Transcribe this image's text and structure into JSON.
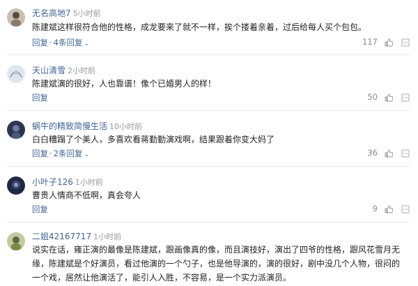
{
  "comments": [
    {
      "user": "无名高地7",
      "time": "5小时前",
      "text": "陈建斌这样很符合他的性格，成龙要来了就不一样，挨个搂着亲着，过后给每人买个包包。",
      "reply_label": "回复",
      "replies_label": "4条回复",
      "likes": "117",
      "avatar_color": "#8a7a6a"
    },
    {
      "user": "天山清雪",
      "time": "2小时前",
      "text": "陈建斌演的很好，人也靠谱！像个已婚男人的样！",
      "reply_label": "回复",
      "likes": "50",
      "avatar_color": "#b9c6d6"
    },
    {
      "user": "蜗牛的精致简慢生活",
      "time": "10小时前",
      "text": "白白糟蹋了个美人，多喜欢看蒋勤勤演戏啊，结果跟着你变大妈了",
      "reply_label": "回复",
      "replies_label": "2条回复",
      "likes": "36",
      "avatar_color": "#4a5a7a"
    },
    {
      "user": "小叶子126",
      "time": "1小时前",
      "text": "曹贵人情商不低啊，真会夸人",
      "reply_label": "回复",
      "likes": "9",
      "avatar_color": "#3a4a6a"
    },
    {
      "user": "二姐42167717",
      "time": "1小时前",
      "text": "说实在话，雍正演的最像是陈建斌，跟画像真的像，而且演技好，演出了四爷的性格，跟风花雪月无缘，陈建斌是个好演员，看过他演的一个勺子，也是他导演的，演的很好，剧中没几个人物，很闷的一个戏，居然让他演活了，能引人入胜，不容易，是一个实力派演员。",
      "avatar_color": "#7a8a4a"
    }
  ]
}
